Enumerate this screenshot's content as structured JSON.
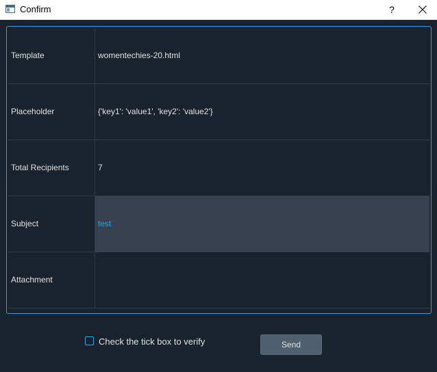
{
  "window": {
    "title": "Confirm",
    "help_label": "?"
  },
  "table": {
    "rows": [
      {
        "label": "Template",
        "value": "womentechies-20.html"
      },
      {
        "label": "Placeholder",
        "value": "{'key1': 'value1', 'key2': 'value2'}"
      },
      {
        "label": "Total Recipients",
        "value": "7"
      },
      {
        "label": "Subject",
        "value": "test",
        "selected": true
      },
      {
        "label": "Attachment",
        "value": ""
      }
    ]
  },
  "verify": {
    "label": "Check the tick box to verify",
    "checked": false
  },
  "send": {
    "label": "Send"
  },
  "colors": {
    "background": "#19232d",
    "accent": "#3d9bd8",
    "selected_row": "#37414f",
    "selected_text": "#2a9fe8",
    "button": "#505f6d"
  },
  "icons": {
    "app": "app-window-icon",
    "close": "close-icon",
    "checkbox": "checkbox-icon"
  }
}
